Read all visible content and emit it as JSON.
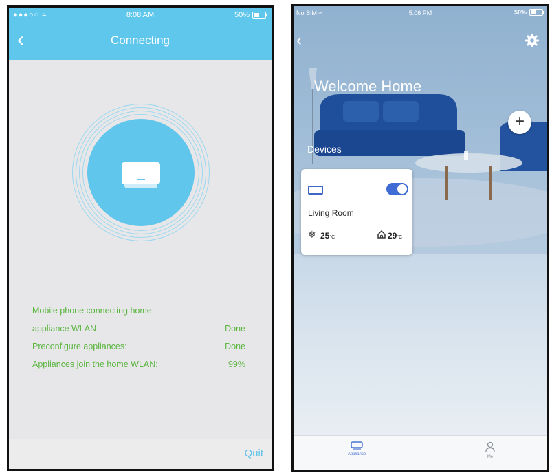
{
  "left_screen": {
    "status_bar": {
      "signal": "●●●○○ ≈",
      "time": "8:08 AM",
      "battery": "50%"
    },
    "nav": {
      "title": "Connecting"
    },
    "steps": [
      {
        "label": "Mobile phone connecting home",
        "value": ""
      },
      {
        "label": "appliance WLAN :",
        "value": "Done"
      },
      {
        "label": "Preconfigure appliances:",
        "value": "Done"
      },
      {
        "label": "Appliances join the home WLAN:",
        "value": "99%"
      }
    ],
    "progress_percent": 99,
    "footer": {
      "quit_label": "Quit"
    },
    "colors": {
      "accent": "#60c7ec",
      "status_text": "#5ab53f",
      "background": "#e7e7e9"
    },
    "icons": [
      "back-chevron-icon",
      "air-conditioner-icon"
    ]
  },
  "right_screen": {
    "status_bar": {
      "carrier": "No SIM ≈",
      "time": "5:06 PM",
      "battery": "50%"
    },
    "header": {
      "welcome": "Welcome Home"
    },
    "section": {
      "devices_label": "Devices"
    },
    "device": {
      "name": "Living Room",
      "power_on": true,
      "set_temp": "25",
      "room_temp": "29",
      "unit": "°C"
    },
    "tabs": [
      {
        "label": "Appliance",
        "icon": "appliance-icon",
        "active": true
      },
      {
        "label": "Me",
        "icon": "person-icon",
        "active": false
      }
    ],
    "colors": {
      "toggle_on": "#3f6bd4",
      "card": "#ffffff"
    },
    "icons": [
      "back-chevron-icon",
      "gear-icon",
      "plus-icon",
      "snowflake-icon",
      "home-icon"
    ]
  }
}
